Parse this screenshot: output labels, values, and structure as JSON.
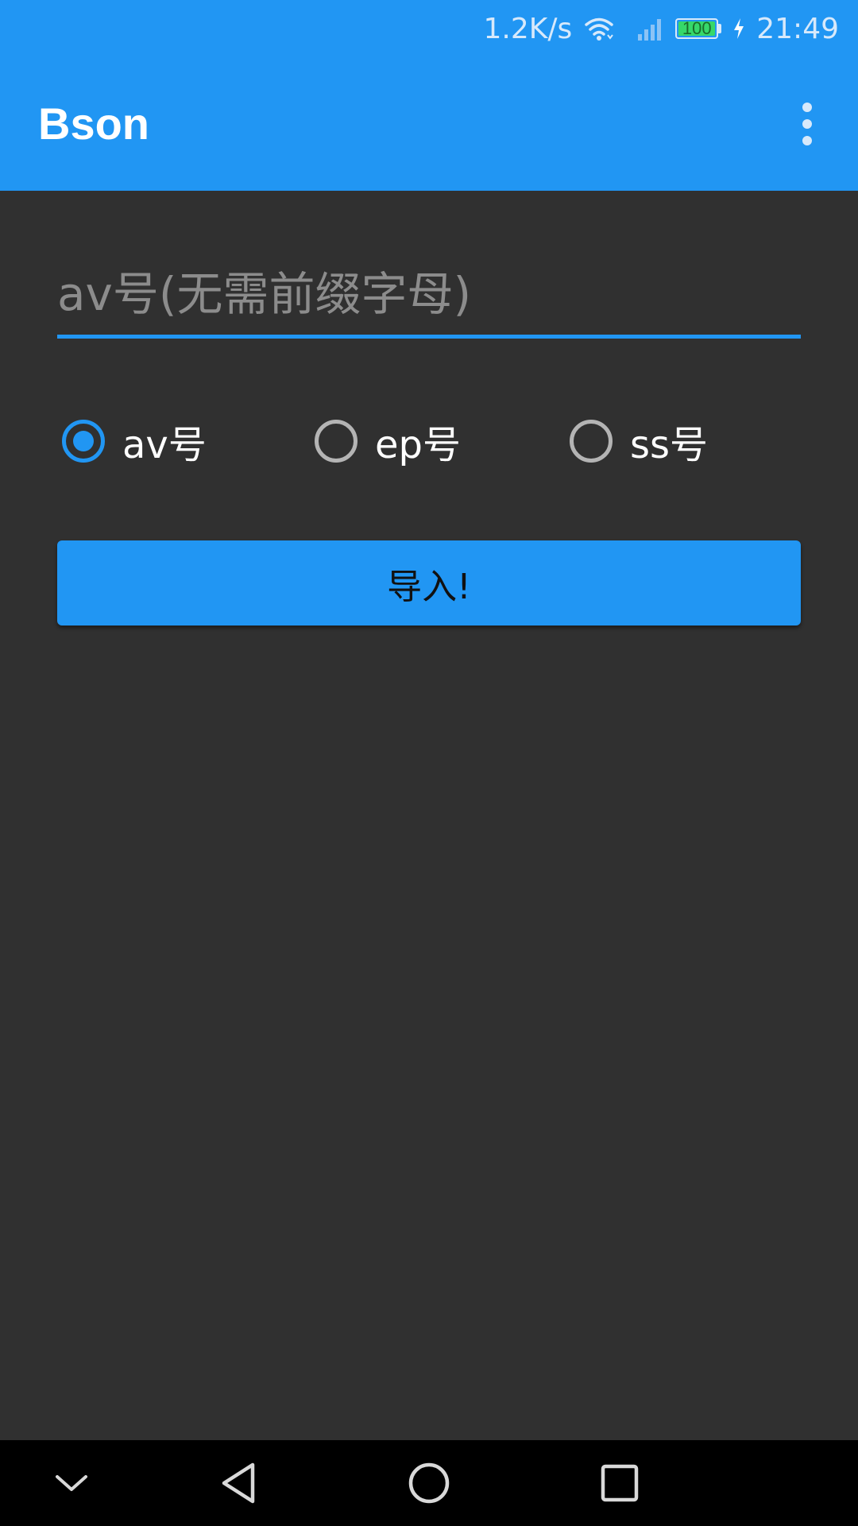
{
  "status_bar": {
    "net_speed": "1.2K/s",
    "battery_level": "100",
    "time": "21:49",
    "icons": [
      "wifi-icon",
      "signal-icon",
      "battery-icon",
      "charging-icon"
    ]
  },
  "app_bar": {
    "title": "Bson",
    "menu_icon": "overflow-menu-icon"
  },
  "form": {
    "input_placeholder": "av号(无需前缀字母)",
    "input_value": "",
    "radios": [
      {
        "label": "av号",
        "checked": true
      },
      {
        "label": "ep号",
        "checked": false
      },
      {
        "label": "ss号",
        "checked": false
      }
    ],
    "button_label": "导入!"
  },
  "nav_bar": {
    "icons": [
      "collapse-chevron-icon",
      "back-icon",
      "home-icon",
      "recents-icon"
    ]
  },
  "colors": {
    "accent": "#2196F3",
    "background": "#303030",
    "nav_background": "#000000"
  }
}
